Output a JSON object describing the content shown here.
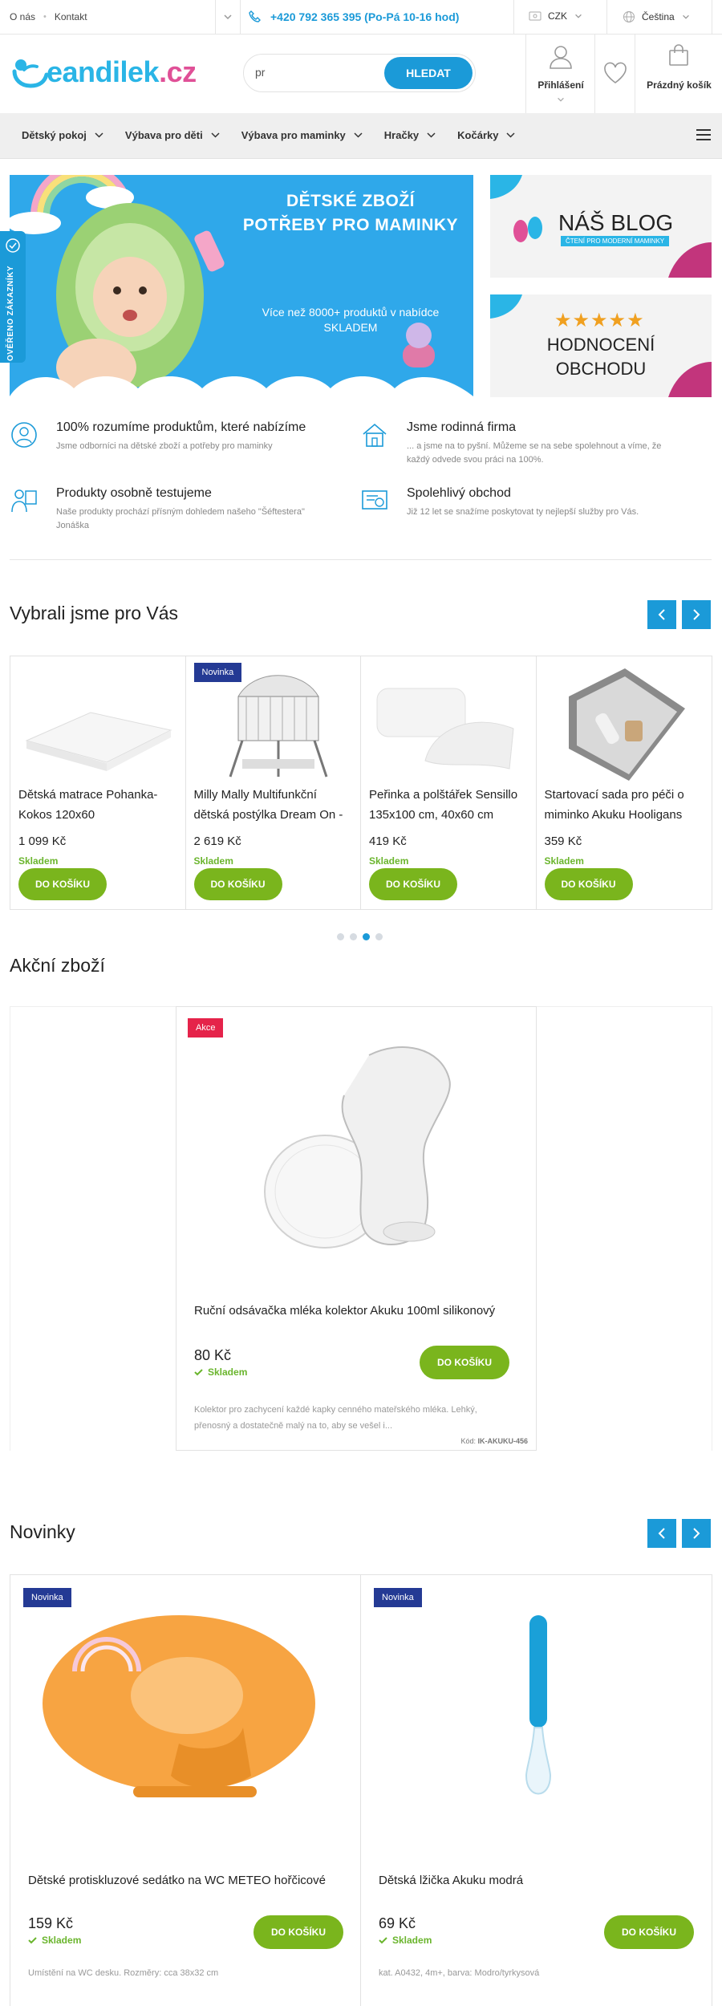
{
  "topbar": {
    "links": [
      "O nás",
      "Kontakt"
    ],
    "phone": "+420 792 365 395 (Po-Pá 10-16 hod)",
    "currency": "CZK",
    "language": "Čeština"
  },
  "header": {
    "logo_text": "eandilek",
    "logo_tld": ".cz",
    "search_value": "pr",
    "search_button": "HLEDAT",
    "login_label": "Přihlášení",
    "cart_label": "Prázdný košík"
  },
  "nav": {
    "items": [
      "Dětský pokoj",
      "Výbava pro děti",
      "Výbava pro maminky",
      "Hračky",
      "Kočárky"
    ]
  },
  "banners": {
    "main_title_1": "DĚTSKÉ ZBOŽÍ",
    "main_title_2": "POTŘEBY PRO MAMINKY",
    "main_sub_1": "Více než 8000+ produktů v nabídce",
    "main_sub_2": "SKLADEM",
    "verified": "OVĚŘENO ZÁKAZNÍKY",
    "blog_title": "NÁŠ BLOG",
    "blog_sub": "ČTENÍ PRO MODERNÍ MAMINKY",
    "review_stars": "★★★★★",
    "review_line_1": "HODNOCENÍ",
    "review_line_2": "OBCHODU"
  },
  "features": [
    {
      "title": "100% rozumíme produktům, které nabízíme",
      "text": "Jsme odborníci na dětské zboží a potřeby pro maminky",
      "icon": "expert-icon"
    },
    {
      "title": "Jsme rodinná firma",
      "text": "... a jsme na to pyšní. Můžeme se na sebe spolehnout a víme, že každý odvede svou práci na 100%.",
      "icon": "house-icon"
    },
    {
      "title": "Produkty osobně testujeme",
      "text": "Naše produkty prochází přísným dohledem našeho \"Šéftestera\" Jonáška",
      "icon": "tester-icon"
    },
    {
      "title": "Spolehlivý obchod",
      "text": "Již 12 let se snažíme poskytovat ty nejlepší služby pro Vás.",
      "icon": "certificate-icon"
    }
  ],
  "picked": {
    "title": "Vybrali jsme pro Vás",
    "products": [
      {
        "name": "Dětská matrace Pohanka-Kokos 120x60",
        "price": "1 099 Kč",
        "stock": "Skladem",
        "button": "DO KOŠÍKU",
        "badge": ""
      },
      {
        "name": "Milly Mally Multifunkční dětská postýlka Dream On -",
        "price": "2 619 Kč",
        "stock": "Skladem",
        "button": "DO KOŠÍKU",
        "badge": "Novinka"
      },
      {
        "name": "Peřinka a polštářek Sensillo 135x100 cm, 40x60 cm",
        "price": "419 Kč",
        "stock": "Skladem",
        "button": "DO KOŠÍKU",
        "badge": ""
      },
      {
        "name": "Startovací sada pro péči o miminko Akuku Hooligans",
        "price": "359 Kč",
        "stock": "Skladem",
        "button": "DO KOŠÍKU",
        "badge": ""
      }
    ]
  },
  "sale": {
    "title": "Akční zboží",
    "badge": "Akce",
    "name": "Ruční odsávačka mléka kolektor Akuku 100ml silikonový",
    "price": "80 Kč",
    "stock": "Skladem",
    "button": "DO KOŠÍKU",
    "desc": "Kolektor pro zachycení každé kapky cenného mateřského mléka. Lehký, přenosný a dostatečně malý na to, aby se vešel i...",
    "code_label": "Kód:",
    "code": "IK-AKUKU-456"
  },
  "news": {
    "title": "Novinky",
    "products": [
      {
        "name": "Dětské protiskluzové sedátko na WC METEO hořčicové",
        "price": "159 Kč",
        "stock": "Skladem",
        "button": "DO KOŠÍKU",
        "badge": "Novinka",
        "desc": "Umístění na WC desku. Rozměry: cca 38x32 cm"
      },
      {
        "name": "Dětská lžička Akuku modrá",
        "price": "69 Kč",
        "stock": "Skladem",
        "button": "DO KOŠÍKU",
        "badge": "Novinka",
        "desc": "kat. A0432, 4m+, barva: Modro/tyrkysová"
      }
    ]
  },
  "colors": {
    "primary": "#1b9ad8",
    "green": "#7ab51d",
    "navy_badge": "#243a94",
    "sale_badge": "#e5234a"
  }
}
